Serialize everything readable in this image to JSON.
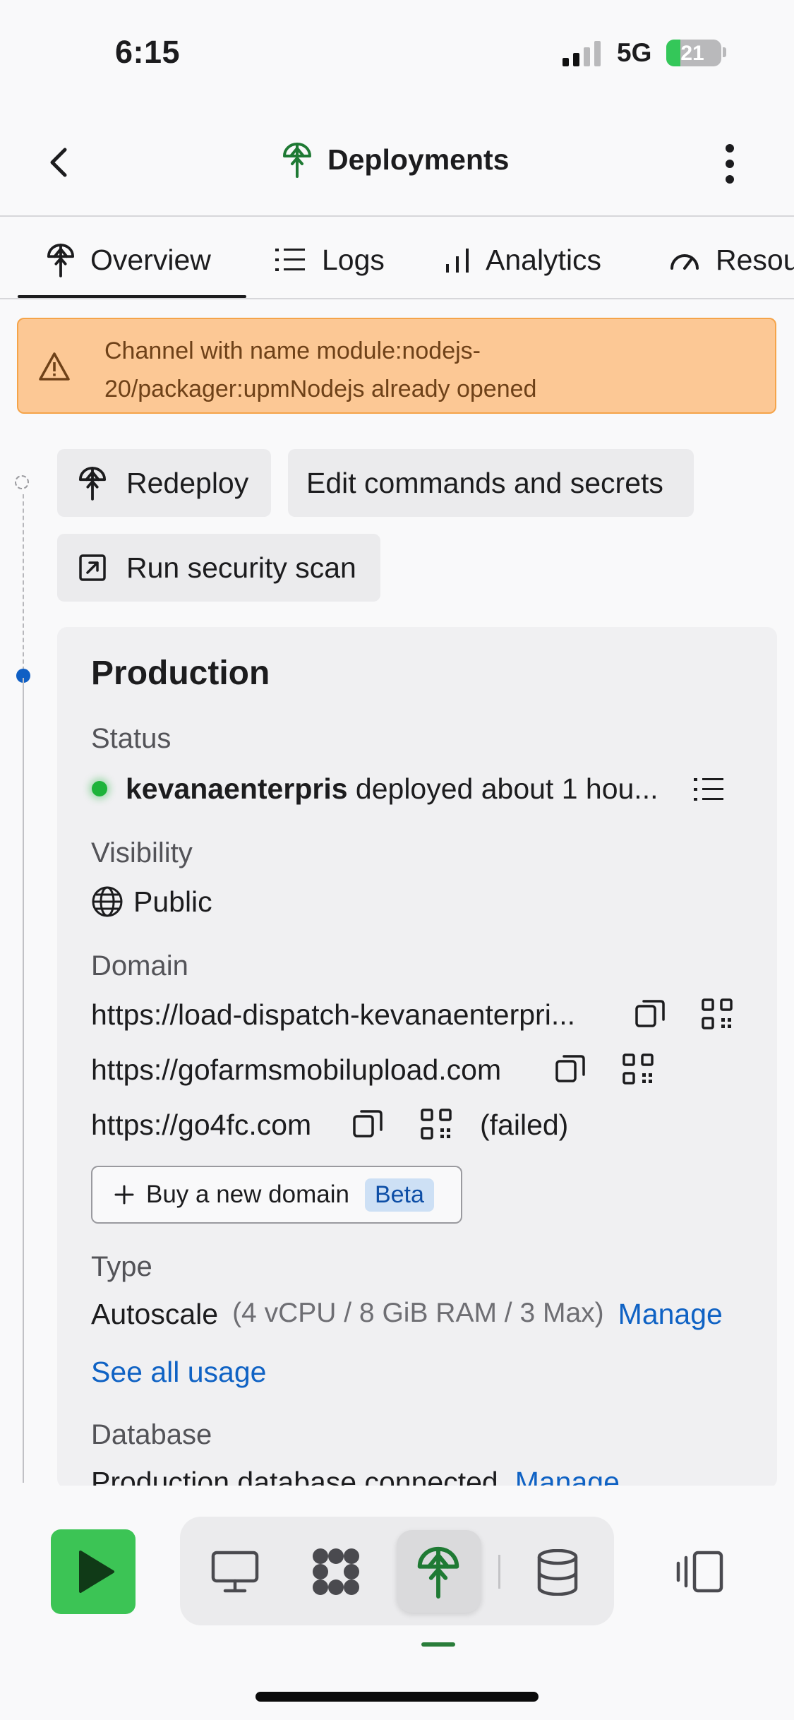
{
  "status_bar": {
    "time": "6:15",
    "network": "5G",
    "battery": "21"
  },
  "header": {
    "title": "Deployments"
  },
  "tabs": [
    {
      "label": "Overview",
      "icon": "deploy-icon"
    },
    {
      "label": "Logs",
      "icon": "list-icon"
    },
    {
      "label": "Analytics",
      "icon": "bar-chart-icon"
    },
    {
      "label": "Resou",
      "icon": "gauge-icon"
    }
  ],
  "banner": {
    "text": "Channel with name module:nodejs-20/packager:upmNodejs already opened"
  },
  "actions": {
    "redeploy": "Redeploy",
    "edit": "Edit commands and secrets",
    "scan": "Run security scan"
  },
  "production": {
    "title": "Production",
    "status_label": "Status",
    "status_user": "kevanaenterpris",
    "status_text": " deployed about 1 hou...",
    "visibility_label": "Visibility",
    "visibility_value": "Public",
    "domain_label": "Domain",
    "domains": [
      "https://load-dispatch-kevanaenterpri...",
      "https://gofarmsmobilupload.com",
      "https://go4fc.com"
    ],
    "domain_failed": "(failed)",
    "buy_domain": "Buy a new domain",
    "beta": "Beta",
    "type_label": "Type",
    "type_value": "Autoscale",
    "type_detail": "(4 vCPU / 8 GiB RAM / 3 Max)",
    "manage": "Manage",
    "see_usage": "See all usage",
    "database_label": "Database",
    "database_value": "Production database connected",
    "database_manage": "Manage"
  },
  "colors": {
    "accent": "#0f62c4",
    "success": "#1db33a",
    "warning_bg": "#fcc895",
    "run_button": "#3cc455"
  }
}
